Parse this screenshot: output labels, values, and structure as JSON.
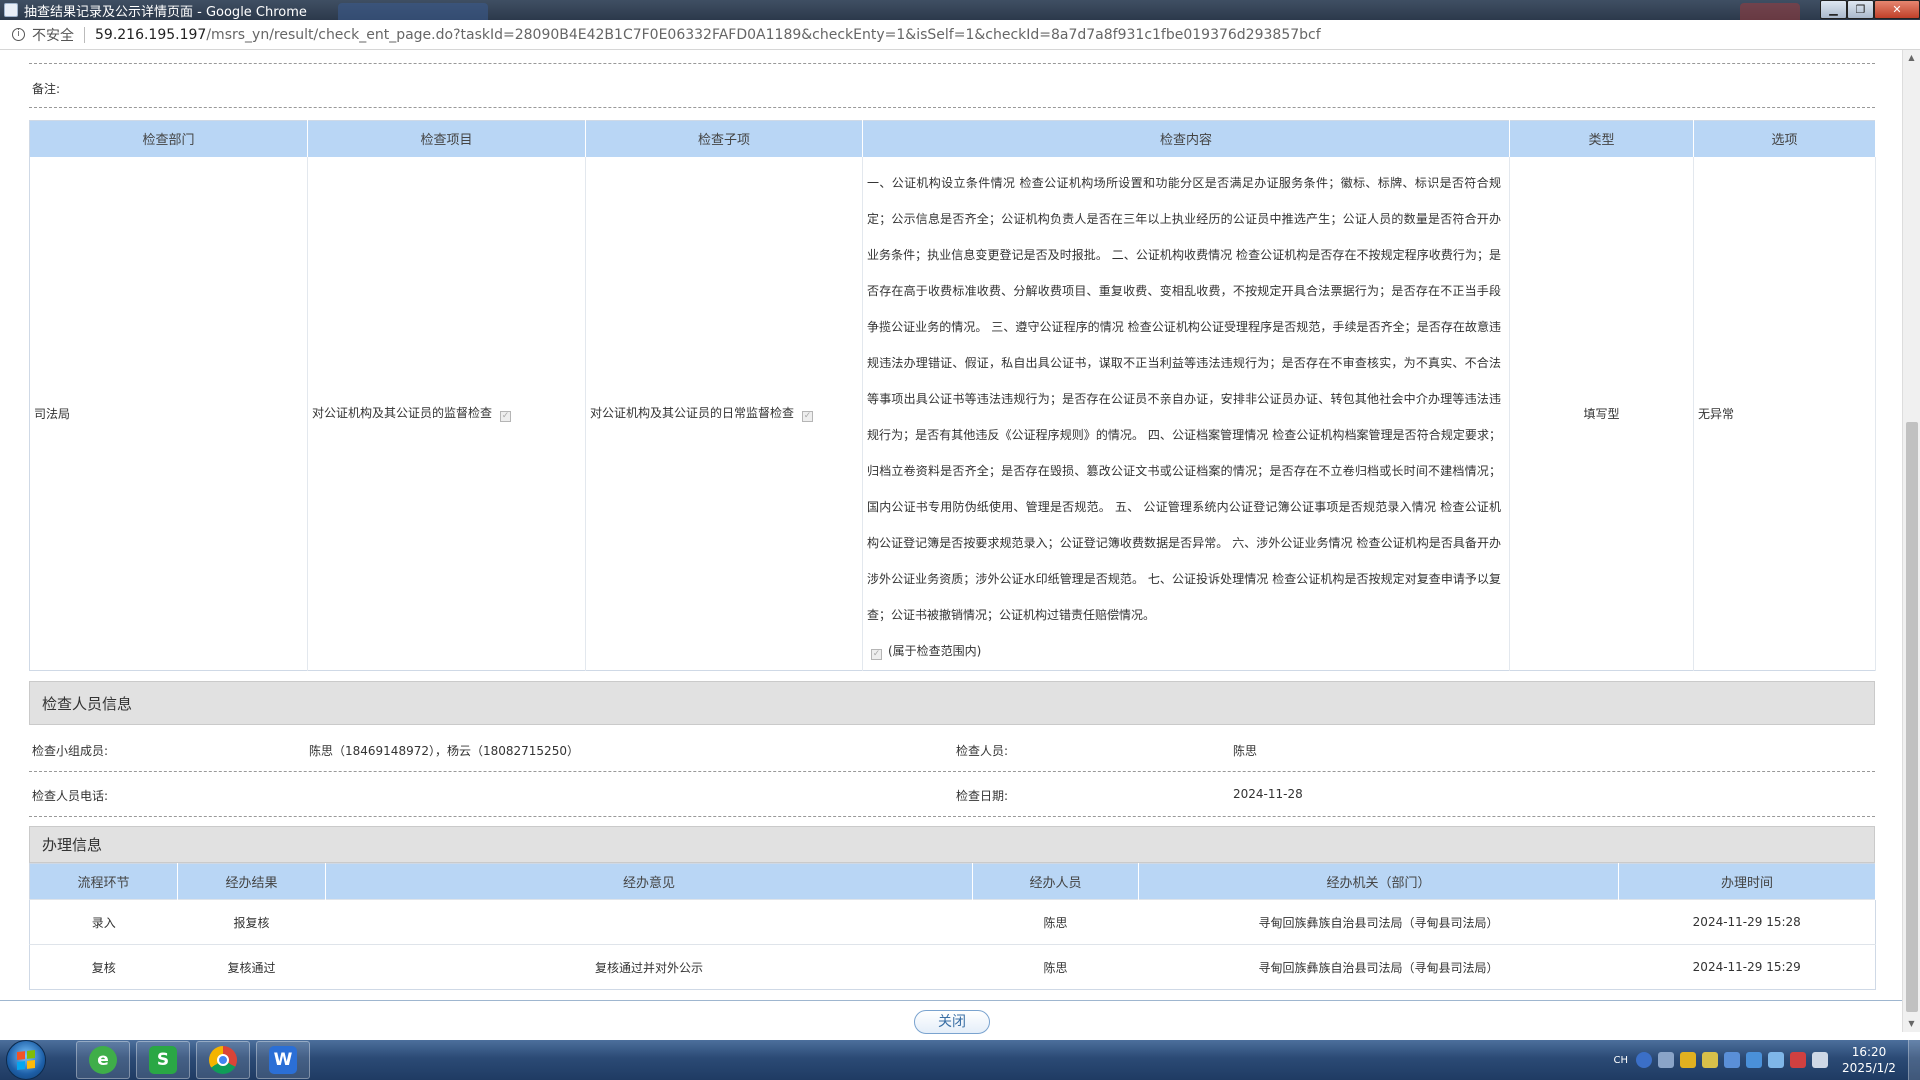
{
  "window": {
    "title": "抽查结果记录及公示详情页面 - Google Chrome",
    "minimize": "▁",
    "maximize": "❐",
    "close": "✕"
  },
  "address_bar": {
    "security_label": "不安全",
    "url_host": "59.216.195.197",
    "url_path": "/msrs_yn/result/check_ent_page.do?taskId=28090B4E42B1C7F0E06332FAFD0A1189&checkEnty=1&isSelf=1&checkId=8a7d7a8f931c1fbe019376d293857bcf"
  },
  "remark": {
    "label": "备注:",
    "value": ""
  },
  "inspection_table": {
    "headers": [
      "检查部门",
      "检查项目",
      "检查子项",
      "检查内容",
      "类型",
      "选项"
    ],
    "row": {
      "department": "司法局",
      "item": "对公证机构及其公证员的监督检查",
      "subitem": "对公证机构及其公证员的日常监督检查",
      "content": "一、公证机构设立条件情况 检查公证机构场所设置和功能分区是否满足办证服务条件；徽标、标牌、标识是否符合规定；公示信息是否齐全；公证机构负责人是否在三年以上执业经历的公证员中推选产生；公证人员的数量是否符合开办业务条件；执业信息变更登记是否及时报批。 二、公证机构收费情况 检查公证机构是否存在不按规定程序收费行为；是否存在高于收费标准收费、分解收费项目、重复收费、变相乱收费，不按规定开具合法票据行为；是否存在不正当手段争揽公证业务的情况。 三、遵守公证程序的情况 检查公证机构公证受理程序是否规范，手续是否齐全；是否存在故意违规违法办理错证、假证，私自出具公证书，谋取不正当利益等违法违规行为；是否存在不审查核实，为不真实、不合法等事项出具公证书等违法违规行为；是否存在公证员不亲自办证，安排非公证员办证、转包其他社会中介办理等违法违规行为；是否有其他违反《公证程序规则》的情况。 四、公证档案管理情况 检查公证机构档案管理是否符合规定要求；归档立卷资料是否齐全；是否存在毁损、篡改公证文书或公证档案的情况；是否存在不立卷归档或长时间不建档情况；国内公证书专用防伪纸使用、管理是否规范。 五、 公证管理系统内公证登记簿公证事项是否规范录入情况 检查公证机构公证登记簿是否按要求规范录入；公证登记簿收费数据是否异常。 六、涉外公证业务情况 检查公证机构是否具备开办涉外公证业务资质；涉外公证水印纸管理是否规范。 七、公证投诉处理情况 检查公证机构是否按规定对复查申请予以复查；公证书被撤销情况；公证机构过错责任赔偿情况。",
      "scope_note": "(属于检查范围内)",
      "type": "填写型",
      "option": "无异常"
    }
  },
  "inspector_section": {
    "title": "检查人员信息",
    "team_label": "检查小组成员:",
    "team_value": "陈思（18469148972），杨云（18082715250）",
    "inspector_label": "检查人员:",
    "inspector_value": "陈思",
    "phone_label": "检查人员电话:",
    "phone_value": "",
    "date_label": "检查日期:",
    "date_value": "2024-11-28"
  },
  "handling_section": {
    "title": "办理信息",
    "headers": [
      "流程环节",
      "经办结果",
      "经办意见",
      "经办人员",
      "经办机关（部门）",
      "办理时间"
    ],
    "rows": [
      {
        "step": "录入",
        "result": "报复核",
        "opinion": "",
        "handler": "陈思",
        "agency": "寻甸回族彝族自治县司法局（寻甸县司法局）",
        "time": "2024-11-29 15:28"
      },
      {
        "step": "复核",
        "result": "复核通过",
        "opinion": "复核通过并对外公示",
        "handler": "陈思",
        "agency": "寻甸回族彝族自治县司法局（寻甸县司法局）",
        "time": "2024-11-29 15:29"
      }
    ]
  },
  "footer": {
    "close_label": "关闭"
  },
  "taskbar": {
    "lang": "CH",
    "time": "16:20",
    "date": "2025/1/2",
    "apps": [
      "browser-360-icon",
      "wps-spreadsheet-icon",
      "chrome-icon",
      "wps-writer-icon"
    ]
  },
  "colors": {
    "table_header": "#b9d6f5",
    "section_header": "#e1e1e1",
    "accent": "#3a6fa5"
  }
}
